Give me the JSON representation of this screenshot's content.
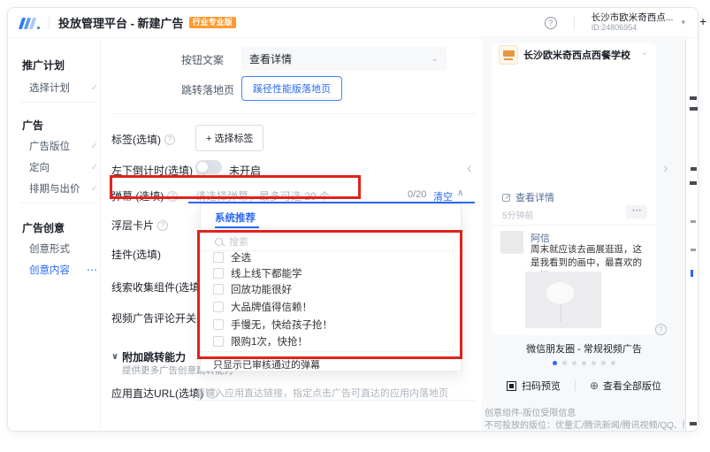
{
  "icons": {
    "help": "?",
    "check": "✓",
    "more": "⋯",
    "select_chevron": "⌄",
    "collapse_chevron": "∨",
    "panel_collapse": "∧",
    "caret_down": "▾",
    "arrow_left": "‹",
    "arrow_right": "›",
    "zoom": "⊕",
    "plus": "+",
    "question": "?"
  },
  "header": {
    "title": "投放管理平台 - 新建广告",
    "badge": "行业专业版",
    "account_name": "长沙市欧米奇西点...",
    "account_id": "ID:24806954"
  },
  "sidebar": {
    "sections": [
      {
        "title": "推广计划",
        "items": [
          {
            "label": "选择计划"
          }
        ]
      },
      {
        "title": "广告",
        "items": [
          {
            "label": "广告版位"
          },
          {
            "label": "定向"
          },
          {
            "label": "排期与出价"
          }
        ]
      },
      {
        "title": "广告创意",
        "items": [
          {
            "label": "创意形式"
          },
          {
            "label": "创意内容"
          }
        ]
      }
    ]
  },
  "form": {
    "button_copy_label": "按钮文案",
    "button_copy_value": "查看详情",
    "landing_label": "跳转落地页",
    "landing_button": "蹊径性能版落地页",
    "tag_label": "标签(选填)",
    "tag_button": "+ 选择标签",
    "countdown_label": "左下倒计时(选填)",
    "countdown_status": "未开启",
    "danmu_label": "弹幕 (选填)",
    "danmu_placeholder": "请选择弹幕，最多可选 20 个",
    "danmu_counter": "0/20",
    "danmu_clear": "清空",
    "float_card_label": "浮层卡片",
    "widget_label": "挂件(选填)",
    "lead_label": "线索收集组件(选填)",
    "comment_switch_label": "视频广告评论开关",
    "extra_jump_title": "附加跳转能力",
    "extra_jump_subtitle": "提供更多广告创意跳转能力",
    "app_url_label": "应用直达URL(选填)",
    "app_url_placeholder": "请输入应用直达链接，指定点击广告可直达的应用内落地页"
  },
  "danmu_dropdown": {
    "tab": "系统推荐",
    "search_placeholder": "搜索",
    "options": [
      "全选",
      "线上线下都能学",
      "回放功能很好",
      "大品牌值得信赖！",
      "手慢无，快给孩子抢！",
      "限购1次，快抢！"
    ],
    "footer": "只显示已审核通过的弹幕"
  },
  "preview": {
    "advertiser": "长沙欧米奇西点西餐学校",
    "cta": "查看详情",
    "time": "5分钟前",
    "commenter": "阿信",
    "comment": "周末就应该去画展逛逛，这是我看到的画中，最喜欢的一幅～",
    "caption": "微信朋友圈 - 常规视频广告",
    "pagination": {
      "total": 7,
      "active_index": 0
    },
    "scan_action": "扫码预览",
    "view_all_action": "查看全部版位",
    "restricted_title": "创意组件-版位受限信息",
    "restricted_text": "不可投放的版位：优量汇/腾讯新闻/腾讯视频/QQ、腾讯音乐及游戏/微信"
  },
  "colors": {
    "accent_blue": "#2a6af2",
    "badge_orange": "#ff9a2e",
    "annotation_red": "#e02319"
  }
}
